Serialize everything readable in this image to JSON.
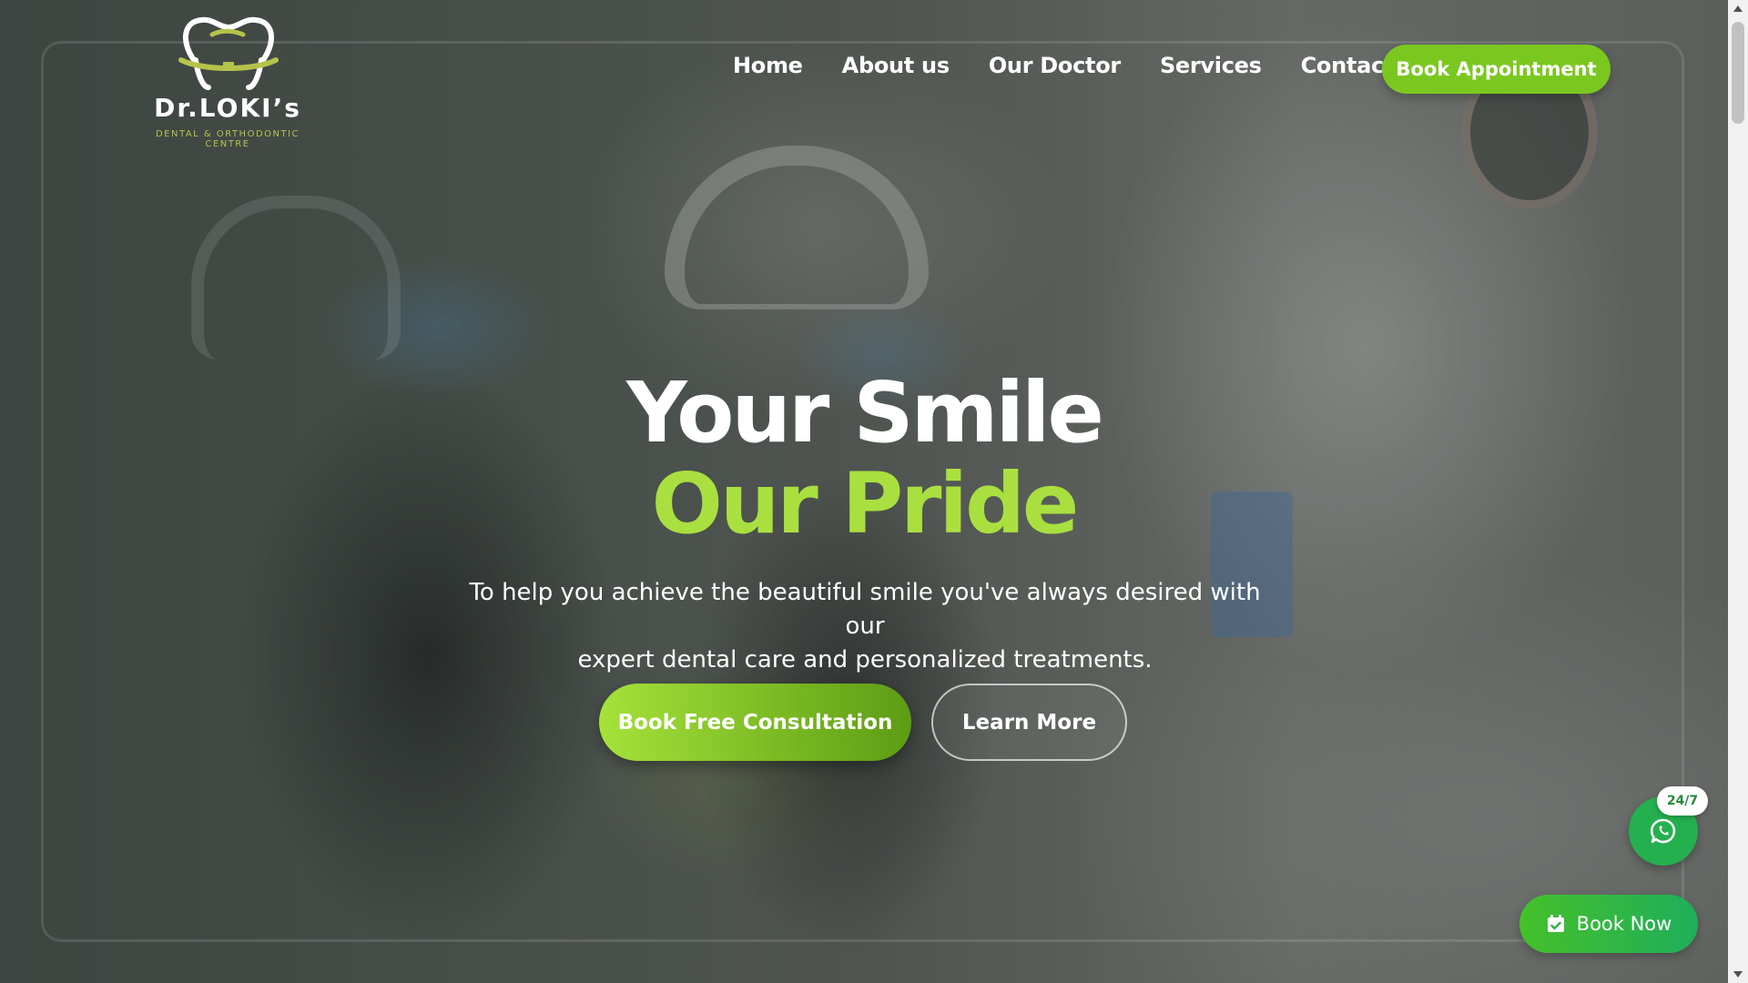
{
  "logo": {
    "title": "Dr.LOKI’s",
    "subtitle": "DENTAL & ORTHODONTIC CENTRE"
  },
  "nav": {
    "items": [
      "Home",
      "About us",
      "Our Doctor",
      "Services",
      "Contact us"
    ],
    "cta": "Book Appointment"
  },
  "hero": {
    "title_line1": "Your Smile",
    "title_line2": "Our Pride",
    "subtitle_line1": "To help you achieve the beautiful smile you've always desired with our",
    "subtitle_line2": "expert dental care and personalized treatments.",
    "primary_button": "Book Free Consultation",
    "secondary_button": "Learn More"
  },
  "widgets": {
    "whatsapp_badge": "24/7",
    "whatsapp_icon": "whatsapp-icon",
    "book_now": "Book Now",
    "book_now_icon": "calendar-check-icon"
  },
  "colors": {
    "accent_green": "#7ac81f",
    "title_green": "#a9e040",
    "whatsapp_green": "#25b04f"
  }
}
